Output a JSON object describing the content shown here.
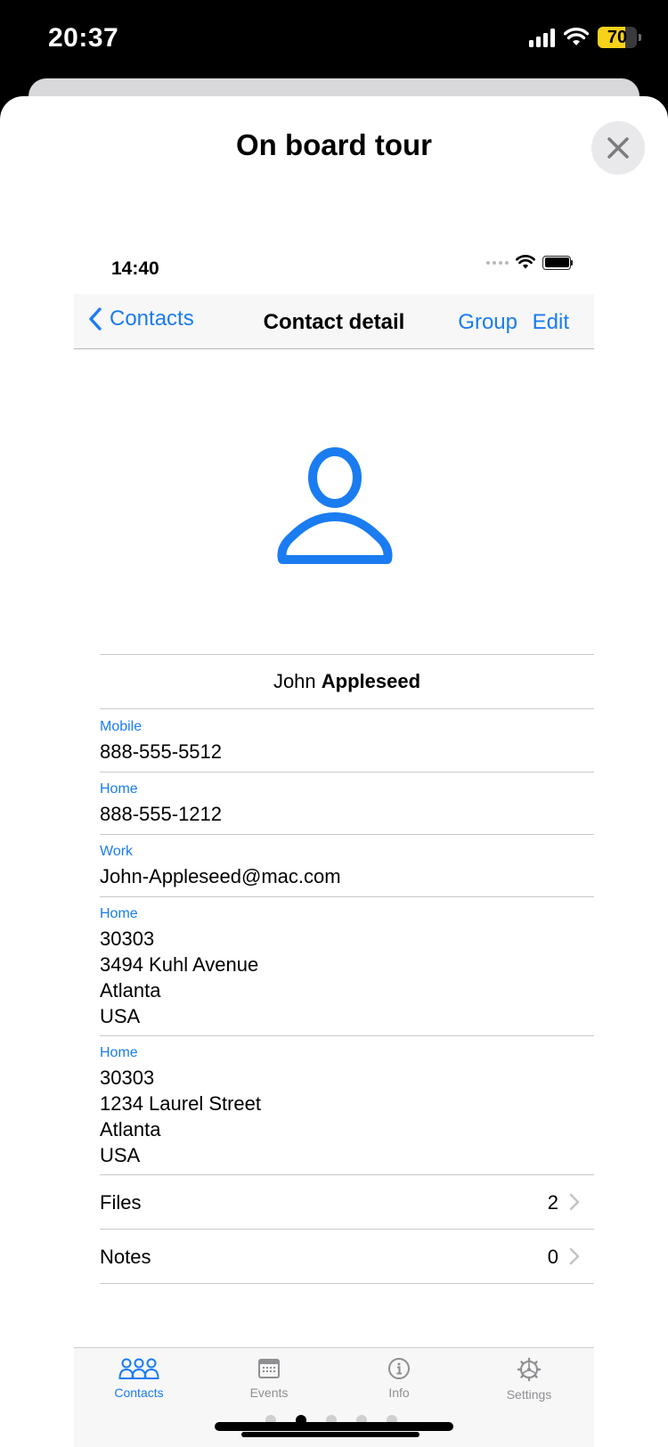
{
  "os_status": {
    "time": "20:37",
    "battery": "70",
    "battery_level": 0.7
  },
  "sheet": {
    "title": "On board tour",
    "close_icon": "close-icon"
  },
  "inner_status": {
    "time": "14:40"
  },
  "navbar": {
    "back_label": "Contacts",
    "title": "Contact detail",
    "group_label": "Group",
    "edit_label": "Edit"
  },
  "contact": {
    "first_name": "John",
    "last_name": "Appleseed",
    "fields": [
      {
        "label": "Mobile",
        "lines": [
          "888-555-5512"
        ]
      },
      {
        "label": "Home",
        "lines": [
          "888-555-1212"
        ]
      },
      {
        "label": "Work",
        "lines": [
          "John-Appleseed@mac.com"
        ]
      },
      {
        "label": "Home",
        "lines": [
          "30303",
          "3494 Kuhl Avenue",
          "Atlanta",
          "USA"
        ]
      },
      {
        "label": "Home",
        "lines": [
          "30303",
          "1234 Laurel Street",
          "Atlanta",
          "USA"
        ]
      }
    ],
    "links": [
      {
        "label": "Files",
        "count": "2"
      },
      {
        "label": "Notes",
        "count": "0"
      }
    ]
  },
  "tabs": [
    {
      "label": "Contacts",
      "icon": "people-icon",
      "active": true
    },
    {
      "label": "Events",
      "icon": "calendar-icon",
      "active": false
    },
    {
      "label": "Info",
      "icon": "info-icon",
      "active": false
    },
    {
      "label": "Settings",
      "icon": "settings-icon",
      "active": false
    }
  ],
  "pager": {
    "count": 5,
    "active_index": 1
  },
  "colors": {
    "accent": "#1A7CF0",
    "inactive_tab": "#8E8E93",
    "battery_yellow": "#F7D21B"
  }
}
